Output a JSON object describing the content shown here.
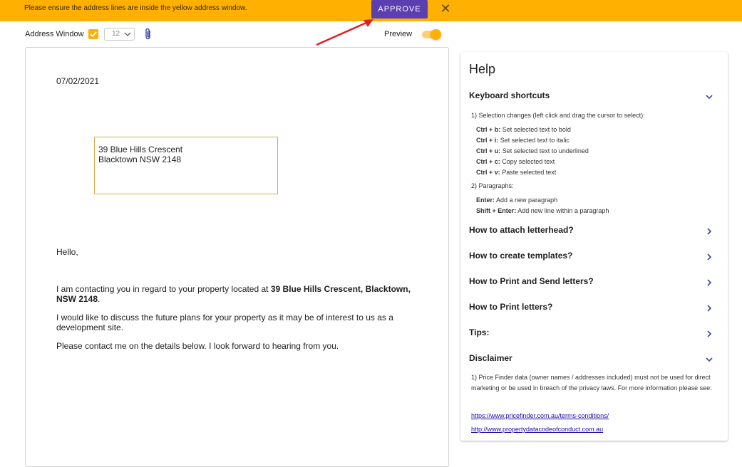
{
  "banner": {
    "message": "Please ensure the address lines are inside the yellow address window.",
    "approve_label": "APPROVE",
    "close_symbol": "✕"
  },
  "toolbar": {
    "address_window_label": "Address Window",
    "address_window_checked": true,
    "font_size": "12",
    "preview_label": "Preview",
    "preview_on": true
  },
  "letter": {
    "date": "07/02/2021",
    "address_line1": "39 Blue Hills Crescent",
    "address_line2": "Blacktown NSW 2148",
    "greeting": "Hello,",
    "p1_before": "I am contacting you in regard to your property located at ",
    "p1_bold": "39 Blue Hills Crescent, Blacktown, NSW 2148",
    "p1_after": ".",
    "p2": "I would like to discuss the future plans for your property as it may be of interest to us as a development site.",
    "p3": "Please contact me on the details below. I look forward to hearing from you."
  },
  "help": {
    "title": "Help",
    "keyboard_title": "Keyboard shortcuts",
    "selection_heading": "1) Selection changes (left click and drag the cursor to select):",
    "shortcuts": [
      {
        "key": "Ctrl + b:",
        "desc": " Set selected text to bold"
      },
      {
        "key": "Ctrl + i:",
        "desc": " Set selected text to italic"
      },
      {
        "key": "Ctrl + u:",
        "desc": " Set selected text to underlined"
      },
      {
        "key": "Ctrl + c:",
        "desc": " Copy selected text"
      },
      {
        "key": "Ctrl + v:",
        "desc": " Paste selected text"
      }
    ],
    "paragraphs_heading": "2) Paragraphs:",
    "para_shortcuts": [
      {
        "key": "Enter:",
        "desc": " Add a new paragraph"
      },
      {
        "key": "Shift + Enter:",
        "desc": " Add new line within a paragraph"
      }
    ],
    "sections": [
      "How to attach letterhead?",
      "How to create templates?",
      "How to Print and Send letters?",
      "How to Print letters?",
      "Tips:"
    ],
    "disclaimer_title": "Disclaimer",
    "disclaimer_text": "1) Price Finder data (owner names / addresses included) must not be used for direct marketing or be used in breach of the privacy laws. For more information please see:",
    "links": [
      "https://www.pricefinder.com.au/terms-conditions/",
      "http://www.propertydatacodeofconduct.com.au"
    ]
  },
  "colors": {
    "banner": "#ffb000",
    "approve": "#5b3fb0",
    "address_border": "#e0a84a",
    "annotation_arrow": "#e02020"
  },
  "icons": [
    "checkmark-icon",
    "chevron-down-icon",
    "paperclip-icon",
    "close-icon",
    "chevron-right-icon",
    "red-arrow-icon"
  ]
}
